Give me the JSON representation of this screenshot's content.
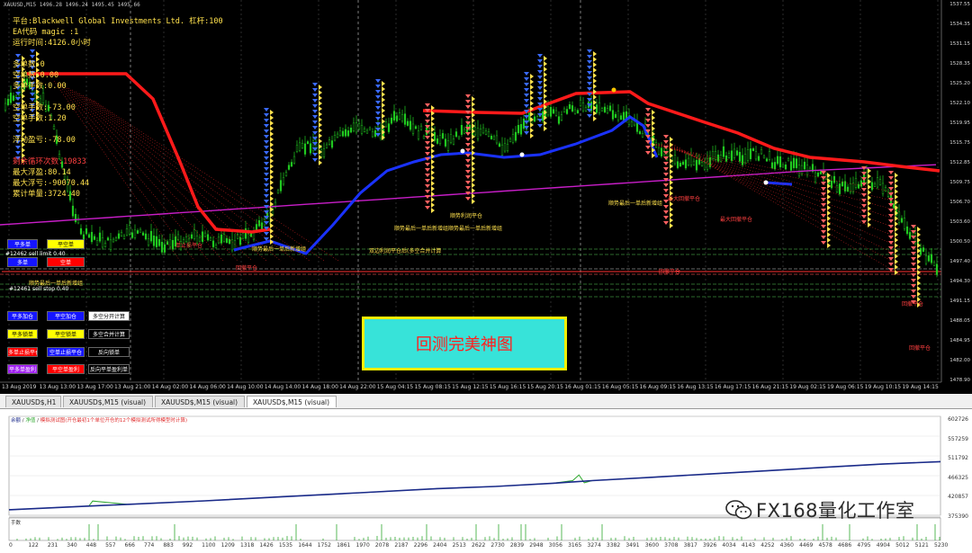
{
  "header": {
    "symbol_line": "XAUUSD,M15  1496.28 1496.24 1495.45 1495.66"
  },
  "info_panel": {
    "lines": [
      {
        "text": "平台:Blackwell Global Investments Ltd. 杠杆:100",
        "color": "yellow"
      },
      {
        "text": "EA代码 magic :1",
        "color": "yellow"
      },
      {
        "text": "运行时间:4126.0小时",
        "color": "yellow"
      },
      {
        "text": "",
        "color": "yellow"
      },
      {
        "text": "多单数:0",
        "color": "yellow"
      },
      {
        "text": "空单数:0.00",
        "color": "yellow"
      },
      {
        "text": "多单手数:0.00",
        "color": "yellow"
      },
      {
        "text": "",
        "color": "yellow"
      },
      {
        "text": "空单手数:-73.00",
        "color": "yellow"
      },
      {
        "text": "空单手数:1.20",
        "color": "yellow"
      },
      {
        "text": "",
        "color": "yellow"
      },
      {
        "text": "浮动盈亏:-78.00",
        "color": "yellow"
      },
      {
        "text": "",
        "color": "yellow"
      },
      {
        "text": "剩余循环次数:19833",
        "color": "red"
      },
      {
        "text": "最大浮盈:80.14",
        "color": "yellow"
      },
      {
        "text": "最大浮亏:-90070.44",
        "color": "yellow"
      },
      {
        "text": "累计单量:3724.40",
        "color": "yellow"
      }
    ]
  },
  "control_panel": {
    "buttons": [
      {
        "label": "平多单",
        "bg": "#1515ff",
        "fg": "#ffffff"
      },
      {
        "label": "平空单",
        "bg": "#ffff00",
        "fg": "#000000"
      },
      {
        "label": "多单",
        "bg": "#1515ff",
        "fg": "#ffffff"
      },
      {
        "label": "空单",
        "bg": "#ff0000",
        "fg": "#ffffff"
      },
      {
        "label": "平多加仓",
        "bg": "#1515ff",
        "fg": "#ffffff"
      },
      {
        "label": "平空加仓",
        "bg": "#1515ff",
        "fg": "#ffffff"
      },
      {
        "label": "多空分开计算",
        "bg": "#ffffff",
        "fg": "#000000"
      },
      {
        "label": "平多锁单",
        "bg": "#ffff00",
        "fg": "#000000"
      },
      {
        "label": "平空锁单",
        "bg": "#ffff00",
        "fg": "#000000"
      },
      {
        "label": "多空合并计算",
        "bg": "#000000",
        "fg": "#ffffff"
      },
      {
        "label": "多单止损平仓",
        "bg": "#ff0000",
        "fg": "#ffffff"
      },
      {
        "label": "空单止损平仓",
        "bg": "#1515ff",
        "fg": "#ffffff"
      },
      {
        "label": "反向锁单",
        "bg": "#000000",
        "fg": "#ffffff"
      },
      {
        "label": "平多单盈利",
        "bg": "#a020f0",
        "fg": "#ffffff"
      },
      {
        "label": "平空单盈利",
        "bg": "#ff0000",
        "fg": "#ffffff"
      },
      {
        "label": "反向平单盈利单",
        "bg": "#000000",
        "fg": "#ffffff"
      }
    ],
    "order_texts": [
      {
        "text": "#12462 sell limit 0.40",
        "color": "#ffffff"
      },
      {
        "text": "#12461 sell stop 0.40",
        "color": "#ffffff"
      },
      {
        "text": "顺势最后一单后新增组",
        "color": "#ffe14d"
      }
    ]
  },
  "chart_annotations": [
    {
      "text": "顺势最后一单后新增组",
      "color": "#ffe14d"
    },
    {
      "text": "双边利润平仓后(多空合并计算",
      "color": "#ffe14d"
    },
    {
      "text": "顺势最后一单后新增组",
      "color": "#ffe14d"
    },
    {
      "text": "顺势最后一单后新增组",
      "color": "#ffe14d"
    },
    {
      "text": "顺势利润平仓",
      "color": "#ffe14d"
    },
    {
      "text": "顺势最后一单后新增组",
      "color": "#ffe14d"
    },
    {
      "text": "单止损平仓",
      "color": "#ff4040"
    },
    {
      "text": "回撤平仓",
      "color": "#ff4040"
    },
    {
      "text": "最大回撤平仓",
      "color": "#ff4040"
    },
    {
      "text": "最大回撤平仓",
      "color": "#ff4040"
    },
    {
      "text": "回撤平仓",
      "color": "#ff4040"
    },
    {
      "text": "回撤平仓",
      "color": "#ff4040"
    },
    {
      "text": "回撤平仓",
      "color": "#ff4040"
    }
  ],
  "banner": {
    "text": "回测完美神图"
  },
  "price_axis": [
    "1537.55",
    "1534.35",
    "1531.15",
    "1528.35",
    "1525.20",
    "1522.10",
    "1519.95",
    "1515.75",
    "1512.85",
    "1509.75",
    "1506.70",
    "1503.60",
    "1500.50",
    "1497.40",
    "1494.30",
    "1491.15",
    "1488.05",
    "1484.95",
    "1482.00",
    "1478.90"
  ],
  "time_axis": [
    "13 Aug 2019",
    "13 Aug 13:00",
    "13 Aug 17:00",
    "13 Aug 21:00",
    "14 Aug 02:00",
    "14 Aug 06:00",
    "14 Aug 10:00",
    "14 Aug 14:00",
    "14 Aug 18:00",
    "14 Aug 22:00",
    "15 Aug 04:15",
    "15 Aug 08:15",
    "15 Aug 12:15",
    "15 Aug 16:15",
    "15 Aug 20:15",
    "16 Aug 01:15",
    "16 Aug 05:15",
    "16 Aug 09:15",
    "16 Aug 13:15",
    "16 Aug 17:15",
    "16 Aug 21:15",
    "19 Aug 02:15",
    "19 Aug 06:15",
    "19 Aug 10:15",
    "19 Aug 14:15"
  ],
  "tabs": [
    {
      "label": "XAUUSD$,H1",
      "active": false
    },
    {
      "label": "XAUUSD$,M15 (visual)",
      "active": false
    },
    {
      "label": "XAUUSD$,M15 (visual)",
      "active": false
    },
    {
      "label": "XAUUSD$,M15 (visual)",
      "active": true
    }
  ],
  "report": {
    "legend_balance": "余额",
    "legend_equity": "净值",
    "legend_text": "模拟测试图(开仓最初1个单位开仓的12个模拟测试所得模型时计算)",
    "volume_title": "手数",
    "y_axis": [
      "602726",
      "557259",
      "511792",
      "466325",
      "420857",
      "375390"
    ],
    "x_axis": [
      "0",
      "122",
      "231",
      "340",
      "448",
      "557",
      "666",
      "774",
      "883",
      "992",
      "1100",
      "1209",
      "1318",
      "1426",
      "1535",
      "1644",
      "1752",
      "1861",
      "1970",
      "2078",
      "2187",
      "2296",
      "2404",
      "2513",
      "2622",
      "2730",
      "2839",
      "2948",
      "3056",
      "3165",
      "3274",
      "3382",
      "3491",
      "3600",
      "3708",
      "3817",
      "3926",
      "4034",
      "4143",
      "4252",
      "4360",
      "4469",
      "4578",
      "4686",
      "4795",
      "4904",
      "5012",
      "5121",
      "5230"
    ]
  },
  "chart_data": {
    "type": "line",
    "title": "",
    "xlabel": "",
    "ylabel": "",
    "ylim": [
      375390,
      602726
    ],
    "x_range": [
      0,
      5230
    ],
    "series": [
      {
        "name": "余额",
        "x": [
          0,
          448,
          666,
          1100,
          1535,
          1970,
          2404,
          2730,
          3056,
          3274,
          3600,
          3926,
          4252,
          4578,
          4904,
          5230
        ],
        "values": [
          388000,
          396500,
          400500,
          408500,
          418000,
          427000,
          436500,
          441500,
          449000,
          455000,
          462500,
          470000,
          477500,
          485500,
          493000,
          498500
        ]
      },
      {
        "name": "净值",
        "x": [
          0,
          448,
          470,
          666,
          1100,
          1535,
          1970,
          2404,
          2730,
          3056,
          3165,
          3200,
          3230,
          3274,
          3600,
          3926,
          4252,
          4578,
          4904,
          5230
        ],
        "values": [
          388000,
          396500,
          408000,
          400500,
          408500,
          418000,
          427000,
          436500,
          441500,
          449000,
          455000,
          468000,
          450000,
          455000,
          462500,
          470000,
          477500,
          485500,
          493000,
          498500
        ]
      }
    ]
  },
  "colors": {
    "balance": "#1a2a8a",
    "equity": "#2ea82e",
    "ma_purple": "#c81ec8",
    "ma_blue": "#1a32ff",
    "ma_red": "#ff1a1a",
    "banner_bg": "#37e3d9",
    "banner_text": "#ff2020"
  },
  "watermark": {
    "text": "FX168量化工作室"
  }
}
